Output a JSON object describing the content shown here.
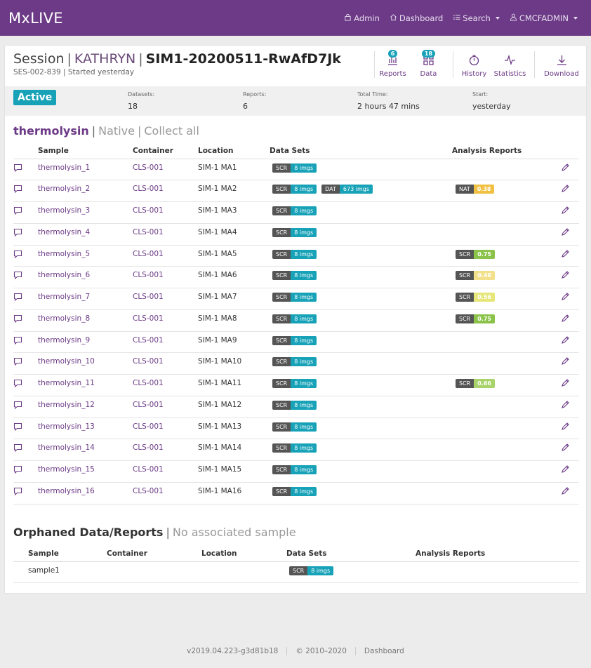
{
  "nav": {
    "brand": "MxLIVE",
    "admin": "Admin",
    "dashboard": "Dashboard",
    "search": "Search",
    "user": "CMCFADMIN"
  },
  "session": {
    "label": "Session",
    "user": "KATHRYN",
    "name": "SIM1-20200511-RwAfD7Jk",
    "code": "SES-002-839",
    "started": "Started yesterday"
  },
  "tools": {
    "reports": {
      "label": "Reports",
      "count": "6"
    },
    "data": {
      "label": "Data",
      "count": "18"
    },
    "history": {
      "label": "History"
    },
    "statistics": {
      "label": "Statistics"
    },
    "download": {
      "label": "Download"
    }
  },
  "stats": {
    "status": "Active",
    "datasets_label": "Datasets:",
    "datasets": "18",
    "reports_label": "Reports:",
    "reports": "6",
    "time_label": "Total Time:",
    "time": "2 hours 47 mins",
    "start_label": "Start:",
    "start": "yesterday"
  },
  "group": {
    "name": "thermolysin",
    "mode": "Native",
    "collect": "Collect all"
  },
  "headers": {
    "sample": "Sample",
    "container": "Container",
    "location": "Location",
    "datasets": "Data Sets",
    "reports": "Analysis Reports"
  },
  "rows": [
    {
      "sample": "thermolysin_1",
      "container": "CLS-001",
      "location": "SIM-1 MA1",
      "datasets": [
        {
          "k": "SCR",
          "v": "8 imgs"
        }
      ],
      "reports": []
    },
    {
      "sample": "thermolysin_2",
      "container": "CLS-001",
      "location": "SIM-1 MA2",
      "datasets": [
        {
          "k": "SCR",
          "v": "8 imgs"
        },
        {
          "k": "DAT",
          "v": "673 imgs"
        }
      ],
      "reports": [
        {
          "k": "NAT",
          "v": "0.38",
          "color": "#f0c040"
        }
      ]
    },
    {
      "sample": "thermolysin_3",
      "container": "CLS-001",
      "location": "SIM-1 MA3",
      "datasets": [
        {
          "k": "SCR",
          "v": "8 imgs"
        }
      ],
      "reports": []
    },
    {
      "sample": "thermolysin_4",
      "container": "CLS-001",
      "location": "SIM-1 MA4",
      "datasets": [
        {
          "k": "SCR",
          "v": "8 imgs"
        }
      ],
      "reports": []
    },
    {
      "sample": "thermolysin_5",
      "container": "CLS-001",
      "location": "SIM-1 MA5",
      "datasets": [
        {
          "k": "SCR",
          "v": "8 imgs"
        }
      ],
      "reports": [
        {
          "k": "SCR",
          "v": "0.75",
          "color": "#8bc34a"
        }
      ]
    },
    {
      "sample": "thermolysin_6",
      "container": "CLS-001",
      "location": "SIM-1 MA6",
      "datasets": [
        {
          "k": "SCR",
          "v": "8 imgs"
        }
      ],
      "reports": [
        {
          "k": "SCR",
          "v": "0.48",
          "color": "#f3e08a"
        }
      ]
    },
    {
      "sample": "thermolysin_7",
      "container": "CLS-001",
      "location": "SIM-1 MA7",
      "datasets": [
        {
          "k": "SCR",
          "v": "8 imgs"
        }
      ],
      "reports": [
        {
          "k": "SCR",
          "v": "0.56",
          "color": "#e6e67a"
        }
      ]
    },
    {
      "sample": "thermolysin_8",
      "container": "CLS-001",
      "location": "SIM-1 MA8",
      "datasets": [
        {
          "k": "SCR",
          "v": "8 imgs"
        }
      ],
      "reports": [
        {
          "k": "SCR",
          "v": "0.75",
          "color": "#8bc34a"
        }
      ]
    },
    {
      "sample": "thermolysin_9",
      "container": "CLS-001",
      "location": "SIM-1 MA9",
      "datasets": [
        {
          "k": "SCR",
          "v": "8 imgs"
        }
      ],
      "reports": []
    },
    {
      "sample": "thermolysin_10",
      "container": "CLS-001",
      "location": "SIM-1 MA10",
      "datasets": [
        {
          "k": "SCR",
          "v": "8 imgs"
        }
      ],
      "reports": []
    },
    {
      "sample": "thermolysin_11",
      "container": "CLS-001",
      "location": "SIM-1 MA11",
      "datasets": [
        {
          "k": "SCR",
          "v": "8 imgs"
        }
      ],
      "reports": [
        {
          "k": "SCR",
          "v": "0.66",
          "color": "#a8d36a"
        }
      ]
    },
    {
      "sample": "thermolysin_12",
      "container": "CLS-001",
      "location": "SIM-1 MA12",
      "datasets": [
        {
          "k": "SCR",
          "v": "8 imgs"
        }
      ],
      "reports": []
    },
    {
      "sample": "thermolysin_13",
      "container": "CLS-001",
      "location": "SIM-1 MA13",
      "datasets": [
        {
          "k": "SCR",
          "v": "8 imgs"
        }
      ],
      "reports": []
    },
    {
      "sample": "thermolysin_14",
      "container": "CLS-001",
      "location": "SIM-1 MA14",
      "datasets": [
        {
          "k": "SCR",
          "v": "8 imgs"
        }
      ],
      "reports": []
    },
    {
      "sample": "thermolysin_15",
      "container": "CLS-001",
      "location": "SIM-1 MA15",
      "datasets": [
        {
          "k": "SCR",
          "v": "8 imgs"
        }
      ],
      "reports": []
    },
    {
      "sample": "thermolysin_16",
      "container": "CLS-001",
      "location": "SIM-1 MA16",
      "datasets": [
        {
          "k": "SCR",
          "v": "8 imgs"
        }
      ],
      "reports": []
    }
  ],
  "orphaned": {
    "title": "Orphaned Data/Reports",
    "subtitle": "No associated sample",
    "rows": [
      {
        "sample": "sample1",
        "container": "",
        "location": "",
        "datasets": [
          {
            "k": "SCR",
            "v": "8 imgs"
          }
        ],
        "reports": []
      }
    ]
  },
  "footer": {
    "version": "v2019.04.223-g3d81b18",
    "copyright": "© 2010–2020",
    "dashboard": "Dashboard"
  }
}
